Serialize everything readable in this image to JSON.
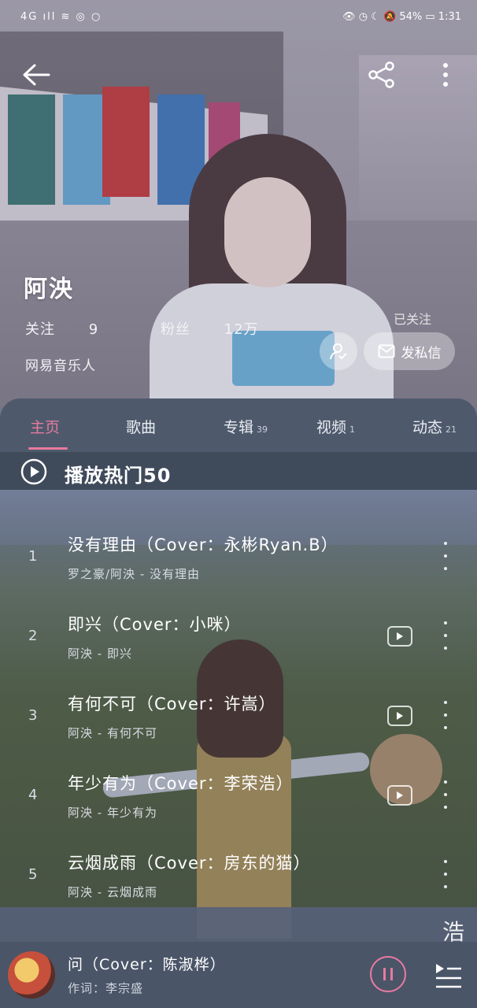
{
  "status_bar": {
    "left": "4G ıll ≋ ◎ ○",
    "right": "👁 ◷ ☾ 🔕 54% ▭ 1:31"
  },
  "header": {
    "name": "阿泱",
    "follow_label": "关注",
    "follow_count": "9",
    "fans_label": "粉丝",
    "fans_count": "12万",
    "role": "网易音乐人",
    "followed_status": "已关注",
    "message_button": "发私信",
    "icons": {
      "back": "back-arrow-icon",
      "share": "share-icon",
      "more": "more-vertical-icon"
    }
  },
  "tabs": [
    {
      "label": "主页",
      "count": "",
      "active": true
    },
    {
      "label": "歌曲",
      "count": ""
    },
    {
      "label": "专辑",
      "count": "39"
    },
    {
      "label": "视频",
      "count": "1"
    },
    {
      "label": "动态",
      "count": "21"
    }
  ],
  "hot_section": {
    "title": "播放热门50",
    "icon": "play-circle-icon"
  },
  "songs": [
    {
      "index": "1",
      "title": "没有理由（Cover：永彬Ryan.B）",
      "subtitle": "罗之豪/阿泱 - 没有理由",
      "has_mv": false
    },
    {
      "index": "2",
      "title": "即兴（Cover：小咪）",
      "subtitle": "阿泱 - 即兴",
      "has_mv": true
    },
    {
      "index": "3",
      "title": "有何不可（Cover：许嵩）",
      "subtitle": "阿泱 - 有何不可",
      "has_mv": true
    },
    {
      "index": "4",
      "title": "年少有为（Cover：李荣浩）",
      "subtitle": "阿泱 - 年少有为",
      "has_mv": true
    },
    {
      "index": "5",
      "title": "云烟成雨（Cover：房东的猫）",
      "subtitle": "阿泱 - 云烟成雨",
      "has_mv": false
    }
  ],
  "side_char": "浩",
  "now_playing": {
    "title": "问（Cover：陈淑桦）",
    "subtitle": "作词：李宗盛"
  },
  "colors": {
    "accent": "#e77aa0",
    "panel": "#4a5566"
  }
}
